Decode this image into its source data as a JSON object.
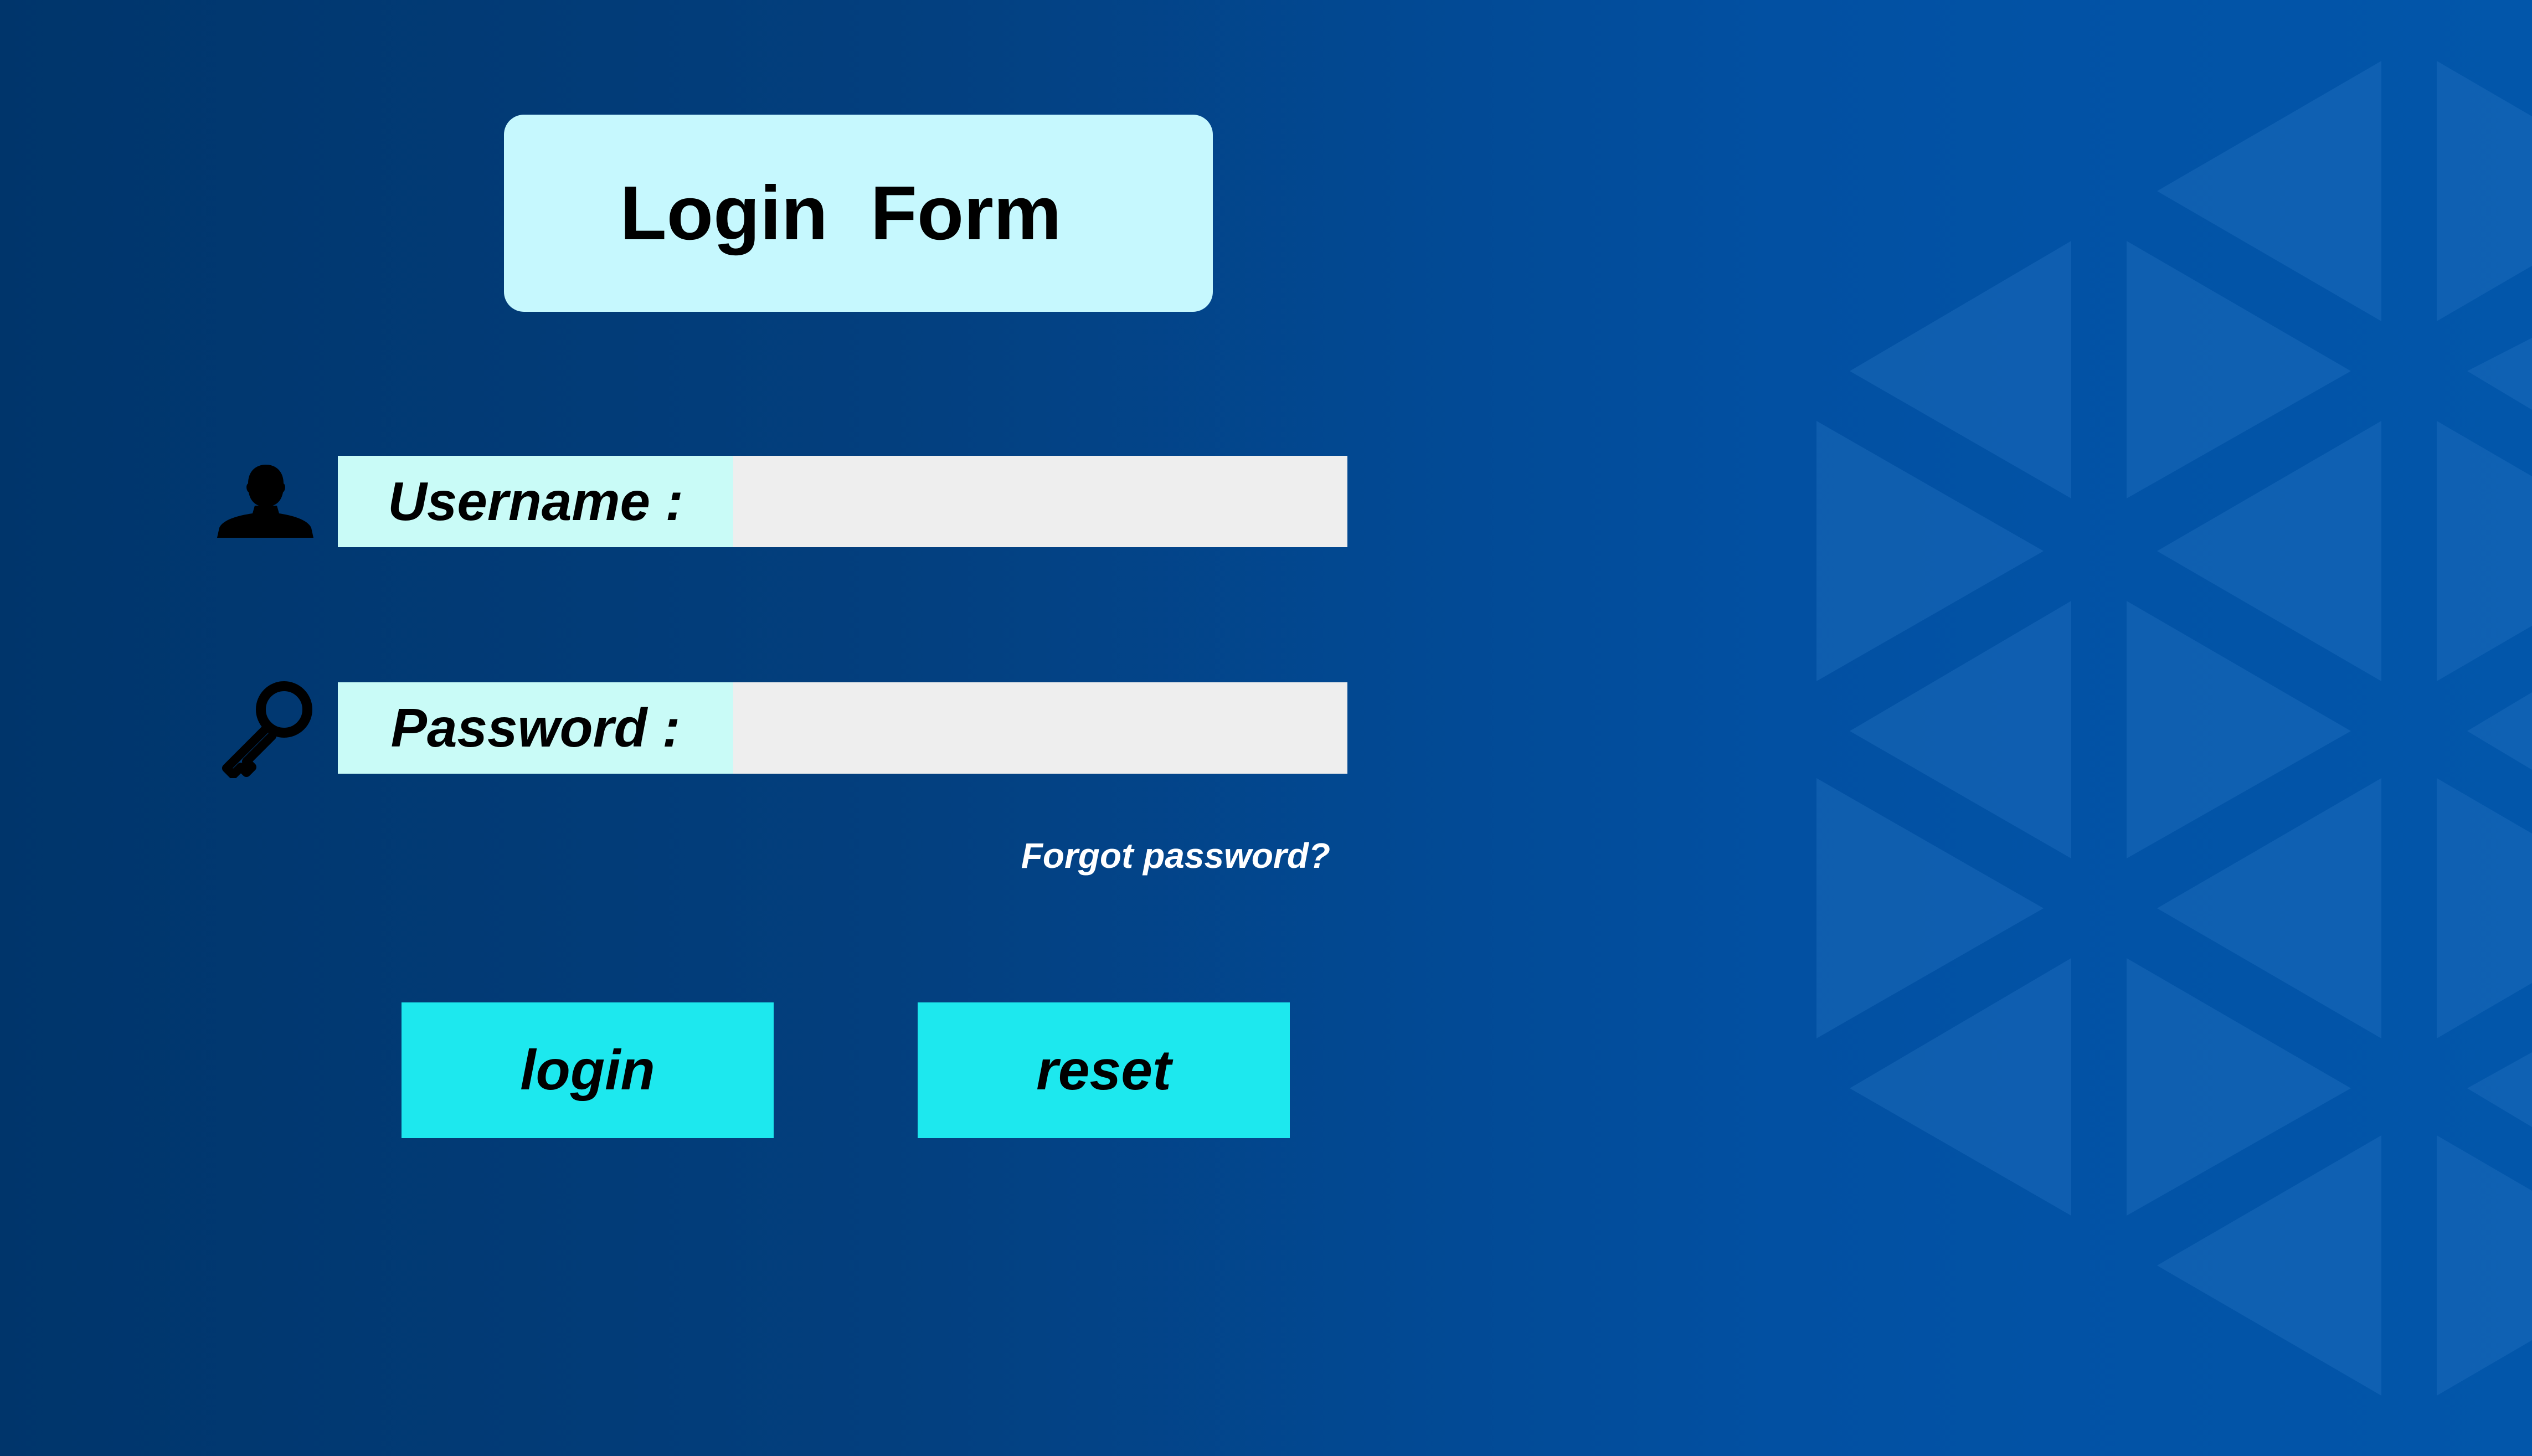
{
  "form": {
    "title": "Login  Form",
    "username_label": "Username :",
    "username_value": "",
    "password_label": "Password :",
    "password_value": "",
    "forgot_link": "Forgot password?"
  },
  "buttons": {
    "login_label": "login",
    "reset_label": "reset"
  },
  "icons": {
    "user": "user-silhouette-icon",
    "password": "key-icon"
  },
  "colors": {
    "background_start": "#00356b",
    "background_end": "#0256aa",
    "title_box": "#c6f8fe",
    "label_box": "#c9fbf7",
    "input_box": "#eeeeee",
    "button": "#1de8ee",
    "link_text": "#ffffff"
  }
}
